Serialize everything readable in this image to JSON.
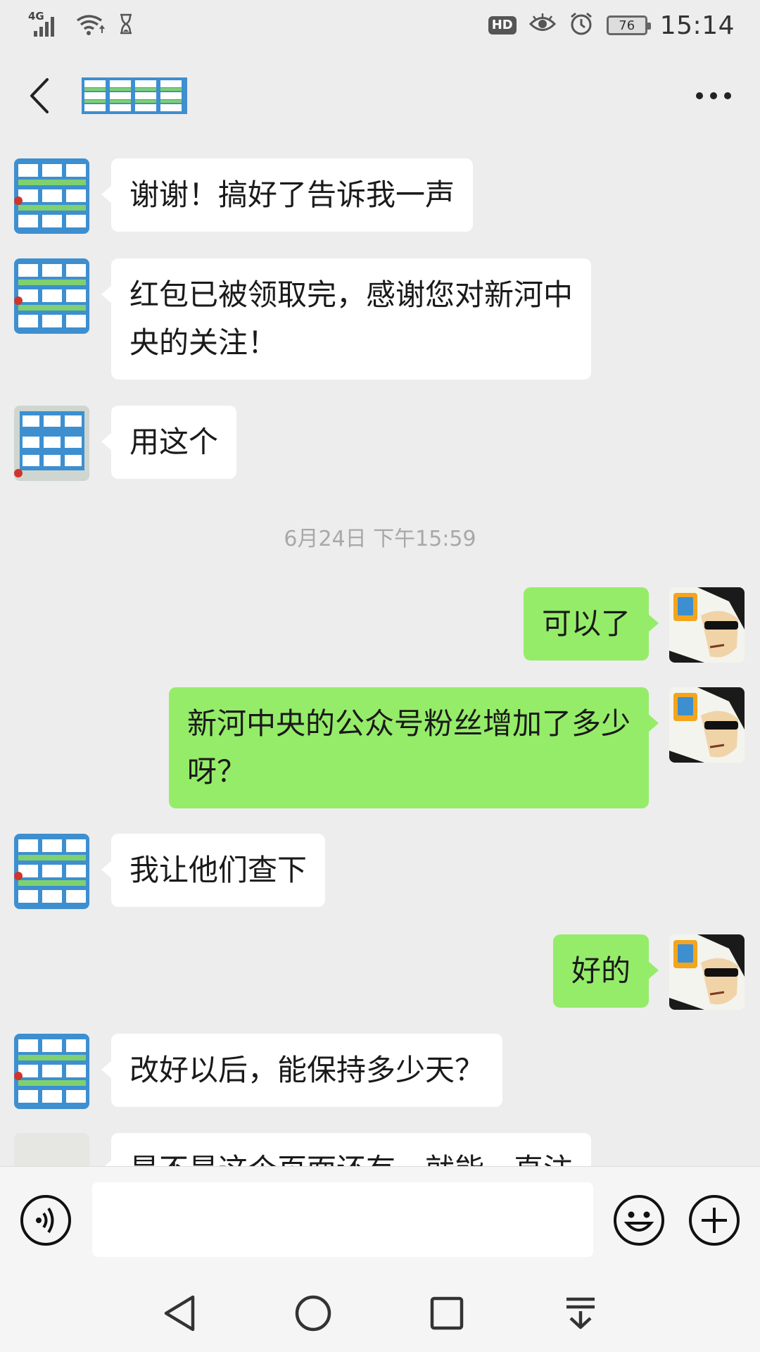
{
  "status_bar": {
    "network": "4G",
    "hd": "HD",
    "battery": "76",
    "time": "15:14"
  },
  "header": {
    "back_icon": "chevron-left-icon",
    "more_icon": "ellipsis-icon"
  },
  "messages": [
    {
      "side": "in",
      "text": "谢谢！搞好了告诉我一声"
    },
    {
      "side": "in",
      "text": "红包已被领取完，感谢您对新河中\n央的关注！"
    },
    {
      "side": "in",
      "text": "用这个"
    },
    {
      "side": "out",
      "text": "可以了"
    },
    {
      "side": "out",
      "text": "新河中央的公众号粉丝增加了多少\n呀？"
    },
    {
      "side": "in",
      "text": "我让他们查下"
    },
    {
      "side": "out",
      "text": "好的"
    },
    {
      "side": "in",
      "text": "改好以后，能保持多少天？"
    },
    {
      "side": "in",
      "text": "是不是这个页面还有一就能一直注"
    }
  ],
  "timestamp": "6月24日 下午15:59",
  "input_bar": {
    "voice_icon": "voice-icon",
    "emoji_icon": "emoji-icon",
    "plus_icon": "plus-icon",
    "value": ""
  },
  "colors": {
    "outgoing_bubble": "#95ec69",
    "incoming_bubble": "#ffffff",
    "background": "#ededed"
  }
}
